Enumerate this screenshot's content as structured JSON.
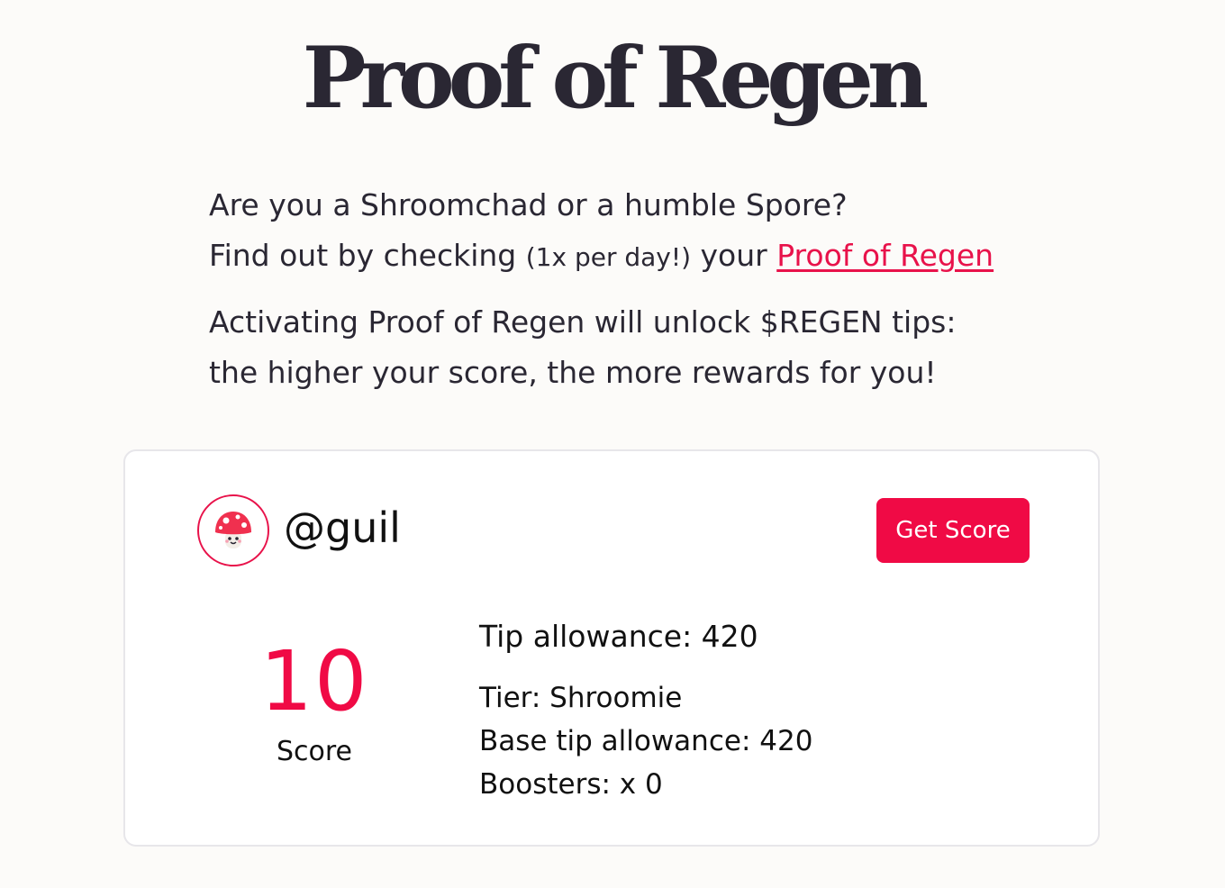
{
  "header": {
    "title": "Proof of Regen"
  },
  "intro": {
    "line1": "Are you a Shroomchad or a humble Spore?",
    "line2_prefix": "Find out by checking ",
    "line2_note": "(1x per day!)",
    "line2_mid": " your ",
    "line2_link": "Proof of Regen",
    "line3": "Activating Proof of Regen will unlock $REGEN tips:",
    "line4": "the higher your score, the more rewards for you!"
  },
  "profile": {
    "avatar_icon": "mushroom-icon",
    "username": "@guil",
    "get_score_label": "Get Score"
  },
  "score": {
    "value": "10",
    "label": "Score"
  },
  "stats": {
    "tip_allowance": "Tip allowance: 420",
    "tier": "Tier: Shroomie",
    "base_tip_allowance": "Base tip allowance: 420",
    "boosters": "Boosters: x 0"
  },
  "colors": {
    "accent": "#f00a45",
    "text": "#2a2733",
    "background": "#fcfbf9"
  }
}
